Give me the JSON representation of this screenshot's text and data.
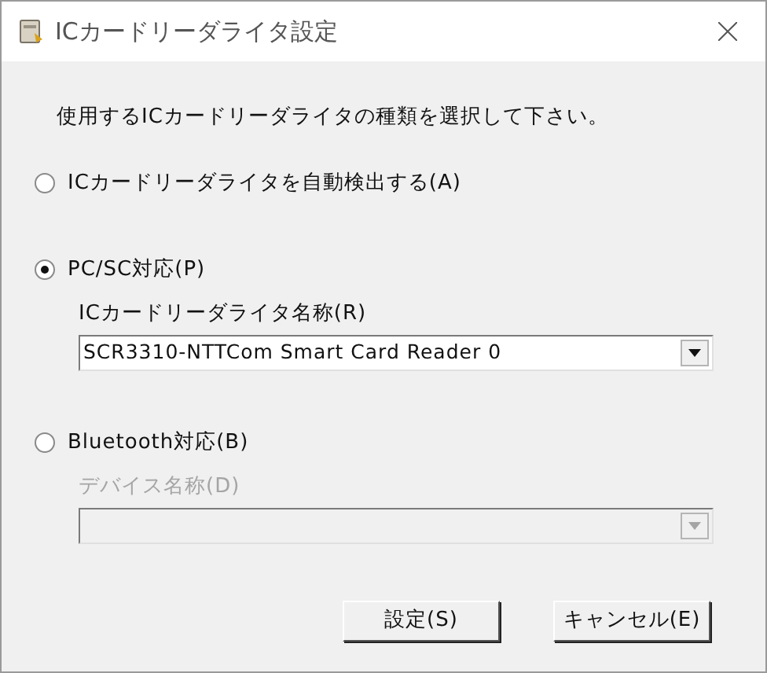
{
  "window": {
    "title": "ICカードリーダライタ設定"
  },
  "instruction": "使用するICカードリーダライタの種類を選択して下さい。",
  "options": [
    {
      "label": "ICカードリーダライタを自動検出する(A)",
      "selected": false
    },
    {
      "label": "PC/SC対応(P)",
      "selected": true,
      "device": {
        "label": "ICカードリーダライタ名称(R)",
        "value": "SCR3310-NTTCom Smart Card Reader 0",
        "disabled": false
      }
    },
    {
      "label": "Bluetooth対応(B)",
      "selected": false,
      "device": {
        "label": "デバイス名称(D)",
        "disabled": true
      }
    }
  ],
  "buttons": [
    "設定(S)",
    "キャンセル(E)"
  ]
}
